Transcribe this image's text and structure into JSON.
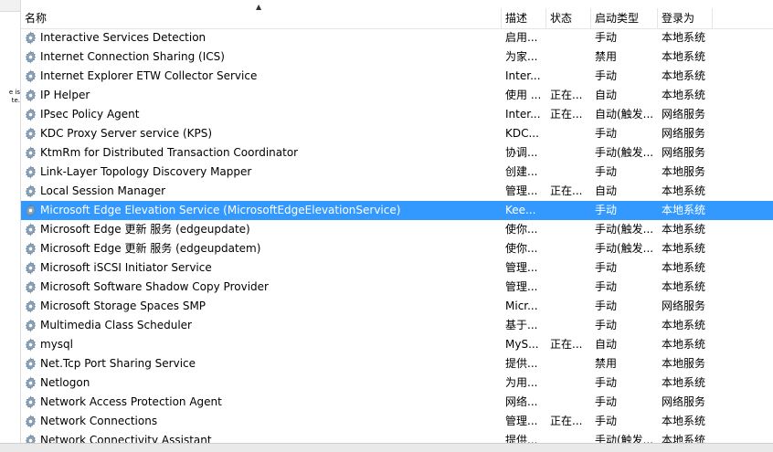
{
  "left_pane": {
    "fragment_1": "e is",
    "fragment_2": "te."
  },
  "columns": {
    "name": "名称",
    "description": "描述",
    "status": "状态",
    "startup": "启动类型",
    "logon": "登录为"
  },
  "rows": [
    {
      "name": "Interactive Services Detection",
      "desc": "启用...",
      "status": "",
      "startup": "手动",
      "logon": "本地系统"
    },
    {
      "name": "Internet Connection Sharing (ICS)",
      "desc": "为家...",
      "status": "",
      "startup": "禁用",
      "logon": "本地系统"
    },
    {
      "name": "Internet Explorer ETW Collector Service",
      "desc": "Inter...",
      "status": "",
      "startup": "手动",
      "logon": "本地系统"
    },
    {
      "name": "IP Helper",
      "desc": "使用 ...",
      "status": "正在...",
      "startup": "自动",
      "logon": "本地系统"
    },
    {
      "name": "IPsec Policy Agent",
      "desc": "Inter...",
      "status": "正在...",
      "startup": "自动(触发...",
      "logon": "网络服务"
    },
    {
      "name": "KDC Proxy Server service (KPS)",
      "desc": "KDC...",
      "status": "",
      "startup": "手动",
      "logon": "网络服务"
    },
    {
      "name": "KtmRm for Distributed Transaction Coordinator",
      "desc": "协调...",
      "status": "",
      "startup": "手动(触发...",
      "logon": "网络服务"
    },
    {
      "name": "Link-Layer Topology Discovery Mapper",
      "desc": "创建...",
      "status": "",
      "startup": "手动",
      "logon": "本地服务"
    },
    {
      "name": "Local Session Manager",
      "desc": "管理...",
      "status": "正在...",
      "startup": "自动",
      "logon": "本地系统"
    },
    {
      "name": "Microsoft Edge Elevation Service (MicrosoftEdgeElevationService)",
      "desc": "Kee...",
      "status": "",
      "startup": "手动",
      "logon": "本地系统",
      "selected": true
    },
    {
      "name": "Microsoft Edge 更新 服务 (edgeupdate)",
      "desc": "使你...",
      "status": "",
      "startup": "手动(触发...",
      "logon": "本地系统"
    },
    {
      "name": "Microsoft Edge 更新 服务 (edgeupdatem)",
      "desc": "使你...",
      "status": "",
      "startup": "手动(触发...",
      "logon": "本地系统"
    },
    {
      "name": "Microsoft iSCSI Initiator Service",
      "desc": "管理...",
      "status": "",
      "startup": "手动",
      "logon": "本地系统"
    },
    {
      "name": "Microsoft Software Shadow Copy Provider",
      "desc": "管理...",
      "status": "",
      "startup": "手动",
      "logon": "本地系统"
    },
    {
      "name": "Microsoft Storage Spaces SMP",
      "desc": "Micr...",
      "status": "",
      "startup": "手动",
      "logon": "网络服务"
    },
    {
      "name": "Multimedia Class Scheduler",
      "desc": "基于...",
      "status": "",
      "startup": "手动",
      "logon": "本地系统"
    },
    {
      "name": "mysql",
      "desc": "MyS...",
      "status": "正在...",
      "startup": "自动",
      "logon": "本地系统"
    },
    {
      "name": "Net.Tcp Port Sharing Service",
      "desc": "提供...",
      "status": "",
      "startup": "禁用",
      "logon": "本地服务"
    },
    {
      "name": "Netlogon",
      "desc": "为用...",
      "status": "",
      "startup": "手动",
      "logon": "本地系统"
    },
    {
      "name": "Network Access Protection Agent",
      "desc": "网络...",
      "status": "",
      "startup": "手动",
      "logon": "网络服务"
    },
    {
      "name": "Network Connections",
      "desc": "管理...",
      "status": "正在...",
      "startup": "手动",
      "logon": "本地系统"
    },
    {
      "name": "Network Connectivity Assistant",
      "desc": "提供...",
      "status": "",
      "startup": "手动(触发...",
      "logon": "本地系统"
    }
  ],
  "colors": {
    "selection": "#3399ff",
    "gear": "#7f9bb5"
  },
  "icons": {
    "row_icon": "service-gear-icon",
    "sort": "sort-ascending-icon"
  }
}
